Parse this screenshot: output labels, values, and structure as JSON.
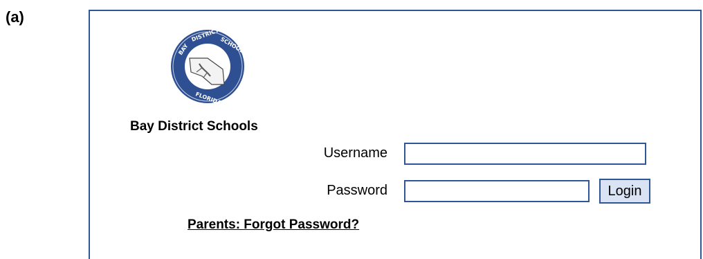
{
  "panel_label": "(a)",
  "header": {
    "organization": "Bay District Schools",
    "logo_icon": "bay-district-schools-seal-icon",
    "logo_text": "BAY DISTRICT SCHOOLS · FLORIDA"
  },
  "form": {
    "username_label": "Username",
    "username_value": "",
    "password_label": "Password",
    "password_value": "",
    "login_label": "Login"
  },
  "links": {
    "forgot_password": "Parents: Forgot Password?"
  },
  "colors": {
    "frame_border": "#2f5597",
    "button_fill": "#dae3f3",
    "seal_ring": "#2e4f91"
  }
}
